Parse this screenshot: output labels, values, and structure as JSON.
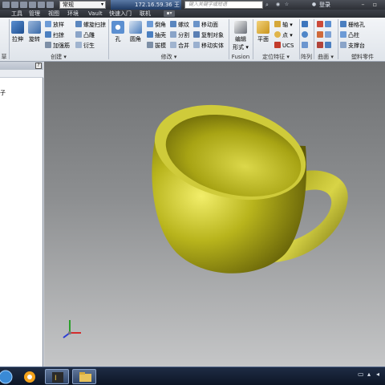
{
  "quick_access": {
    "appearance_select": "常规",
    "title_text": "172.16.59.36 王",
    "search_placeholder": "键入关键字或短语",
    "login_label": "登录"
  },
  "menu_tabs": [
    {
      "label": "工具"
    },
    {
      "label": "管理"
    },
    {
      "label": "视图"
    },
    {
      "label": "环境"
    },
    {
      "label": "Vault"
    },
    {
      "label": "快速入门"
    },
    {
      "label": "联机"
    }
  ],
  "ribbon": {
    "create": {
      "panel_label": "创建",
      "extrude": "拉伸",
      "revolve": "旋转",
      "loft": "放样",
      "sweep": "扫掠",
      "rib": "加强筋",
      "coil": "螺旋扫掠",
      "emboss": "凸雕",
      "derive": "衍生"
    },
    "modify": {
      "panel_label": "修改",
      "hole": "孔",
      "fillet": "圆角",
      "chamfer": "倒角",
      "shell": "抽壳",
      "draft": "拔模",
      "thread": "螺纹",
      "split": "分割",
      "combine": "合并",
      "move_face": "移动面",
      "copy_object": "复制对象",
      "move_bodies": "移动实体"
    },
    "fusion": {
      "panel_label": "Fusion",
      "edit_form_line1": "编辑",
      "edit_form_line2": "形式"
    },
    "work_features": {
      "panel_label": "定位特征",
      "plane": "平面",
      "axis": "轴",
      "point": "点",
      "ucs": "UCS"
    },
    "pattern": {
      "panel_label": "阵列"
    },
    "surface": {
      "panel_label": "曲面"
    },
    "plastic_part": {
      "panel_label": "塑料零件",
      "grill": "栅格孔",
      "boss": "凸柱",
      "rest": "支撑台"
    },
    "left_panel_label": "草图"
  },
  "browser": {
    "help_button": "?",
    "tree_item": "子"
  },
  "colors": {
    "cup": "#b8b41c",
    "cup_highlight": "#f2ee6a",
    "cup_shadow": "#5e5a06"
  }
}
